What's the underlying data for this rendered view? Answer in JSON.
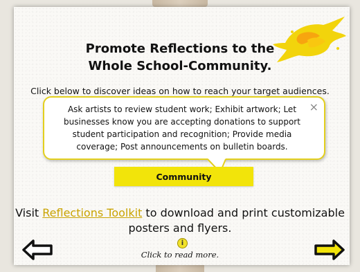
{
  "header": {
    "title_line1": "Promote Reflections to the",
    "title_line2": "Whole School-Community."
  },
  "subtitle": "Click below to discover ideas on how to reach your target audiences.",
  "callout": {
    "text": "Ask artists to review student work; Exhibit artwork; Let businesses know you are accepting donations to support student participation and recognition; Provide media coverage; Post announcements on bulletin boards.",
    "close_icon": "×"
  },
  "community_button": "Community",
  "footer": {
    "visit_prefix": "Visit ",
    "link_text": "Reflections Toolkit",
    "visit_suffix": " to download and print customizable posters and flyers.",
    "info_icon": "i",
    "read_more": "Click to read more."
  },
  "colors": {
    "accent_yellow": "#f2e40a",
    "callout_border": "#e3cf1c",
    "link": "#c9a300"
  }
}
